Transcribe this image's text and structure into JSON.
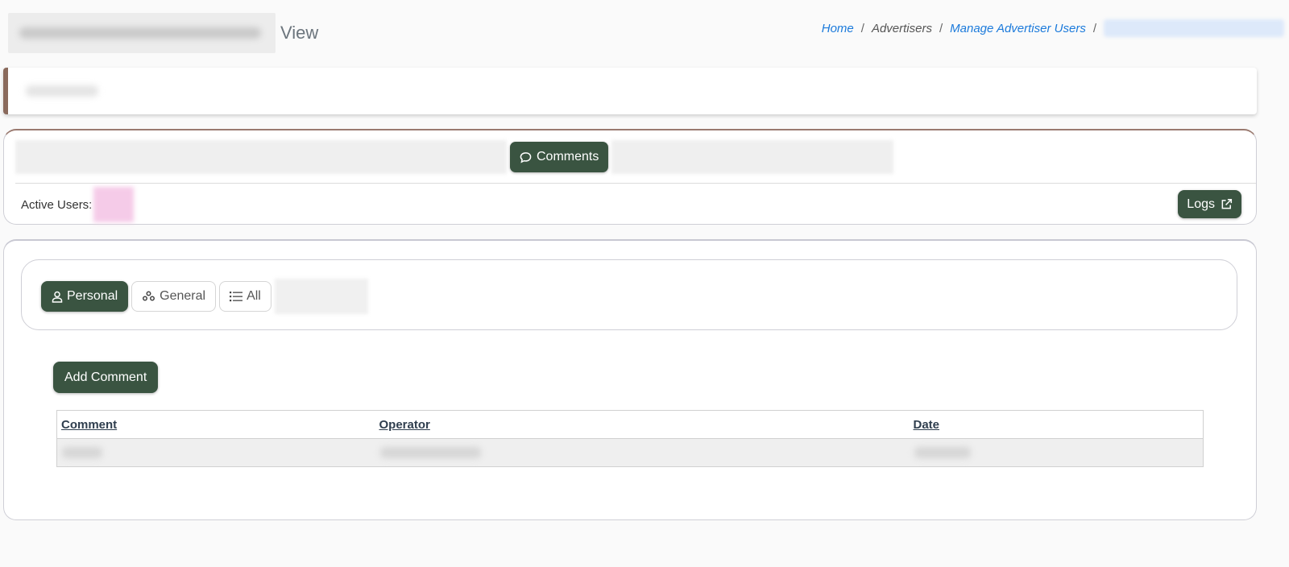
{
  "header": {
    "title_suffix": "View"
  },
  "breadcrumb": {
    "home": "Home",
    "advertisers": "Advertisers",
    "manage_advertiser_users": "Manage Advertiser Users",
    "separator": "/"
  },
  "tabs": {
    "active_label": "Comments"
  },
  "status": {
    "active_users_label": "Active Users:"
  },
  "toolbar": {
    "logs_label": "Logs"
  },
  "subtabs": [
    {
      "label": "Personal",
      "icon": "user-icon"
    },
    {
      "label": "General",
      "icon": "users-group-icon"
    },
    {
      "label": "All",
      "icon": "list-icon"
    }
  ],
  "actions": {
    "add_comment_label": "Add Comment"
  },
  "table": {
    "columns": [
      "Comment",
      "Operator",
      "Date"
    ]
  },
  "colors": {
    "primary_button": "#3a5441",
    "link": "#1b7adb",
    "accent_border": "#8a6a5c"
  }
}
